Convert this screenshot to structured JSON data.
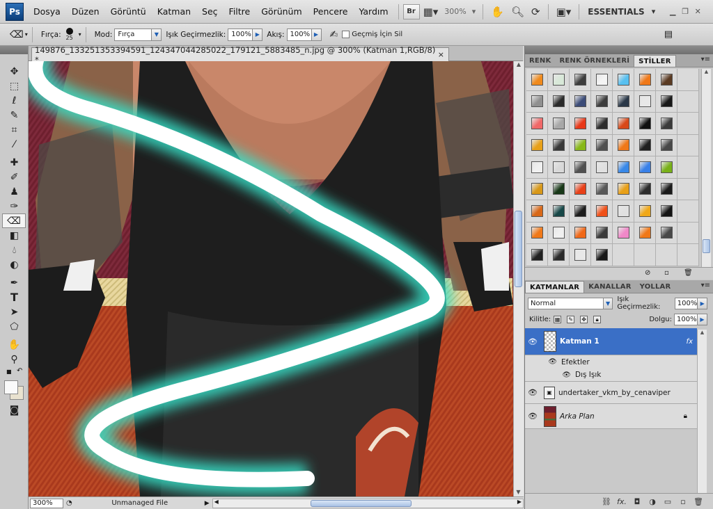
{
  "app": {
    "logo": "Ps"
  },
  "menu": [
    "Dosya",
    "Düzen",
    "Görüntü",
    "Katman",
    "Seç",
    "Filtre",
    "Görünüm",
    "Pencere",
    "Yardım"
  ],
  "appbar": {
    "bridge_label": "Br",
    "zoom": "300%",
    "workspace": "ESSENTIALS",
    "icons": [
      "film-strip-icon",
      "hand-icon",
      "zoom-icon",
      "rotate-view-icon",
      "arrange-icon"
    ]
  },
  "options": {
    "brush_label": "Fırça:",
    "brush_size": "25",
    "mode_label": "Mod:",
    "mode_value": "Fırça",
    "opacity_label": "Işık Geçirmezlik:",
    "opacity_value": "100%",
    "flow_label": "Akış:",
    "flow_value": "100%",
    "history_label": "Geçmiş İçin Sil"
  },
  "document": {
    "tab_title": "149876_133251353394591_124347044285022_179121_5883485_n.jpg @ 300% (Katman 1,RGB/8) *",
    "close": "×"
  },
  "status": {
    "zoom": "300%",
    "text": "Unmanaged File"
  },
  "tools": [
    "move-tool-icon",
    "marquee-tool-icon",
    "lasso-tool-icon",
    "quick-select-tool-icon",
    "crop-tool-icon",
    "eyedropper-tool-icon",
    "spot-heal-tool-icon",
    "brush-tool-icon",
    "clone-stamp-tool-icon",
    "history-brush-tool-icon",
    "eraser-tool-icon",
    "gradient-tool-icon",
    "blur-tool-icon",
    "dodge-tool-icon",
    "pen-tool-icon",
    "type-tool-icon",
    "path-select-tool-icon",
    "shape-tool-icon",
    "hand-tool-icon",
    "zoom-tool-icon"
  ],
  "styles_panel": {
    "tabs": [
      "RENK",
      "RENK ÖRNEKLERİ",
      "STİLLER"
    ],
    "swatches": [
      "#f08a1c",
      "#d8e8d8",
      "#3c3c3c",
      "#f4f4f4",
      "#58c0f0",
      "#f07818",
      "#5a3a22",
      "#ffffff",
      "#909090",
      "#2a2a2a",
      "#3c4c78",
      "#3c3c3c",
      "#2a3848",
      "#e8e8e8",
      "#181818",
      "#ffffff",
      "#f06868",
      "#a8a8a8",
      "#e83818",
      "#2c2c2c",
      "#d84818",
      "#101010",
      "#3a3a3a",
      "#ffffff",
      "#e8a018",
      "#383838",
      "#88b818",
      "#505050",
      "#f07818",
      "#202020",
      "#484848",
      "#ffffff",
      "#f0f0f0",
      "#d8d8d8",
      "#505050",
      "#e0e0e0",
      "#3888e8",
      "#3880e8",
      "#78b018",
      "#ffffff",
      "#d89818",
      "#183818",
      "#e84018",
      "#585858",
      "#e8a018",
      "#2c2c2c",
      "#1a1a1a",
      "#ffffff",
      "#d86818",
      "#184848",
      "#1c1c1c",
      "#f05018",
      "#e0e0e0",
      "#f0a818",
      "#141414",
      "#ffffff",
      "#f07818",
      "#f0f0f0",
      "#f06818",
      "#3a3a3a",
      "#f088c8",
      "#f07818",
      "#484848",
      "#ffffff",
      "#202020",
      "#2a2a2a",
      "#e8e8e8",
      "#181818",
      "#ffffff",
      "#ffffff",
      "#ffffff",
      "#ffffff"
    ]
  },
  "layers_panel": {
    "tabs": [
      "KATMANLAR",
      "KANALLAR",
      "YOLLAR"
    ],
    "blend_mode": "Normal",
    "opacity_label": "Işık Geçirmezlik:",
    "opacity_value": "100%",
    "lock_label": "Kilitle:",
    "fill_label": "Dolgu:",
    "fill_value": "100%",
    "layers": [
      {
        "name": "Katman 1",
        "fx": "fx",
        "selected": true
      },
      {
        "name": "Efektler"
      },
      {
        "name": "Dış Işık"
      },
      {
        "name": "undertaker_vkm_by_cenaviper"
      },
      {
        "name": "Arka Plan"
      }
    ]
  }
}
